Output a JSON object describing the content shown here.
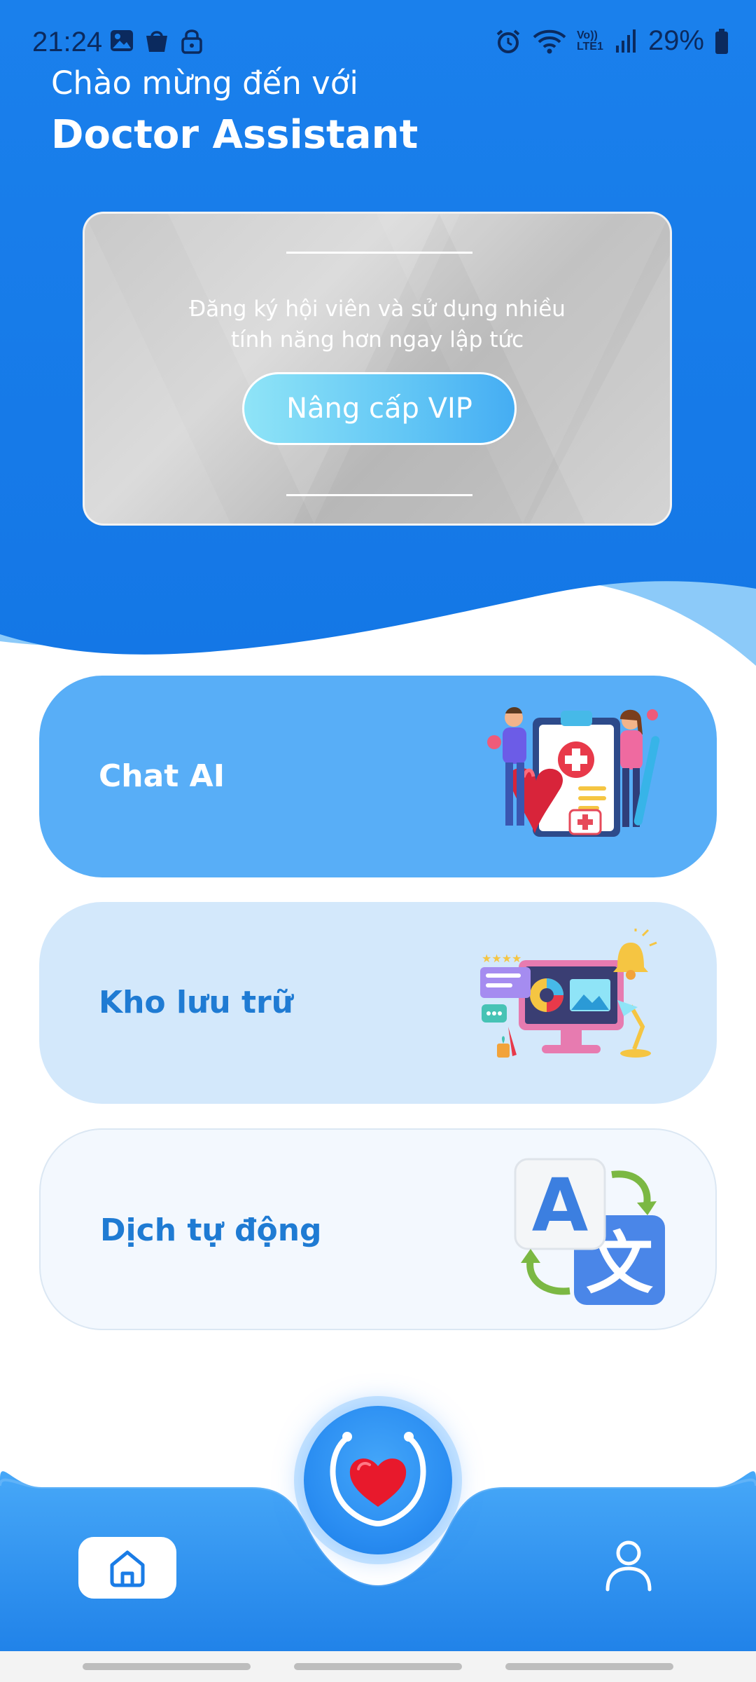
{
  "status_bar": {
    "time": "21:24",
    "left_icons": [
      "gallery-icon",
      "shopping-bag-icon",
      "lock-icon"
    ],
    "right_icons": [
      "alarm-icon",
      "wifi-icon",
      "volte-icon",
      "signal-icon",
      "battery-icon"
    ],
    "volte_label": "Vo)) LTE1",
    "battery_percent": "29%"
  },
  "header": {
    "welcome_text": "Chào mừng đến với",
    "app_name": "Doctor Assistant"
  },
  "vip_card": {
    "line1": "Đăng ký hội viên và sử dụng nhiều",
    "line2": "tính năng hơn ngay lập tức",
    "button_label": "Nâng cấp VIP"
  },
  "features": {
    "chat": {
      "label": "Chat AI",
      "icon": "medical-team-illustration"
    },
    "storage": {
      "label": "Kho lưu trữ",
      "icon": "monitor-media-illustration"
    },
    "translate": {
      "label": "Dịch tự động",
      "icon": "translate-icon"
    }
  },
  "bottom_nav": {
    "home_icon": "home-icon",
    "center_icon": "stethoscope-heart-icon",
    "profile_icon": "profile-icon"
  },
  "colors": {
    "primary_blue": "#1a7ee8",
    "light_wave": "#8ccaf9",
    "chat_card": "#58aef7",
    "storage_card": "#d3e8fb",
    "translate_card": "#f3f8fe",
    "accent_text": "#1f7bd3",
    "heart_red": "#e8192c"
  }
}
